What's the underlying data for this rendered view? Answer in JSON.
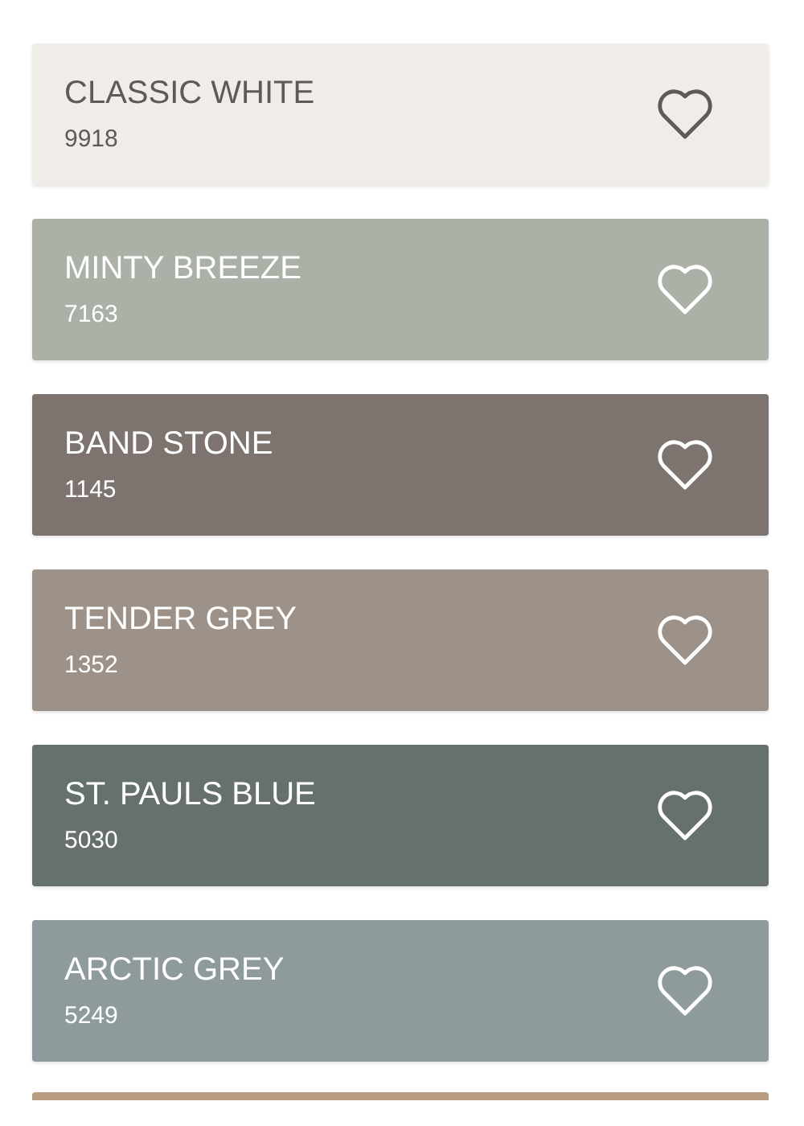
{
  "swatches": [
    {
      "name": "CLASSIC WHITE",
      "code": "9918",
      "color": "#f0ede8",
      "kind": "light"
    },
    {
      "name": "MINTY BREEZE",
      "code": "7163",
      "color": "#abb1a7",
      "kind": "dark"
    },
    {
      "name": "BAND STONE",
      "code": "1145",
      "color": "#7e746f",
      "kind": "dark"
    },
    {
      "name": "TENDER GREY",
      "code": "1352",
      "color": "#9c9289",
      "kind": "dark"
    },
    {
      "name": "ST. PAULS BLUE",
      "code": "5030",
      "color": "#66716f",
      "kind": "dark"
    },
    {
      "name": "ARCTIC GREY",
      "code": "5249",
      "color": "#8f9a9d",
      "kind": "dark"
    }
  ],
  "next_swatch": {
    "color": "#b89c80"
  }
}
